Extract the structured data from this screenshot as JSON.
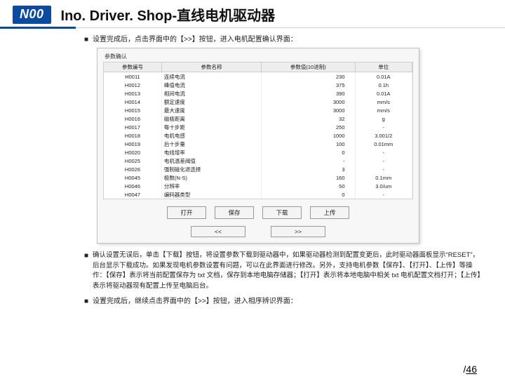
{
  "header": {
    "badge": "N00",
    "title": "Ino. Driver. Shop-直线电机驱动器"
  },
  "bullet1": "设置完成后，点击界面中的【>>】按钮，进入电机配置确认界面：",
  "win": {
    "group_label": "参数确认",
    "columns": [
      "参数编号",
      "参数名称",
      "参数值(10进制)",
      "单位"
    ],
    "rows": [
      {
        "id": "H0011",
        "name": "连续电流",
        "val": "230",
        "unit": "0.01A"
      },
      {
        "id": "H0012",
        "name": "峰值电流",
        "val": "375",
        "unit": "0.1h"
      },
      {
        "id": "H0013",
        "name": "相间电流",
        "val": "390",
        "unit": "0.01A"
      },
      {
        "id": "H0014",
        "name": "额定速度",
        "val": "3000",
        "unit": "mm/s"
      },
      {
        "id": "H0015",
        "name": "最大速度",
        "val": "3000",
        "unit": "mm/s"
      },
      {
        "id": "H0016",
        "name": "磁极距离",
        "val": "32",
        "unit": "g"
      },
      {
        "id": "H0017",
        "name": "每十步距",
        "val": "250",
        "unit": "-"
      },
      {
        "id": "H0018",
        "name": "电机电感",
        "val": "1000",
        "unit": "3.001/2"
      },
      {
        "id": "H0019",
        "name": "后十步量",
        "val": "100",
        "unit": "0.01mm"
      },
      {
        "id": "H0020",
        "name": "电线增率",
        "val": "0",
        "unit": "-"
      },
      {
        "id": "H0025",
        "name": "电机温差阈值",
        "val": "-",
        "unit": "-"
      },
      {
        "id": "H0026",
        "name": "强制磁化退选择",
        "val": "3",
        "unit": "-"
      },
      {
        "id": "H0045",
        "name": "极数(N-S)",
        "val": "160",
        "unit": "0.1mm"
      },
      {
        "id": "H0046",
        "name": "分辨率",
        "val": "50",
        "unit": "3.0/um"
      },
      {
        "id": "H0047",
        "name": "编码器类型",
        "val": "0",
        "unit": "-"
      }
    ],
    "btns1": {
      "open": "打开",
      "save": "保存",
      "download": "下载",
      "upload": "上传"
    },
    "btns2": {
      "prev": "<<",
      "next": ">>"
    }
  },
  "para1": "确认设置无误后，单击【下载】按钮，将设置参数下载到驱动器中，如果驱动器检测到配置变更后，此时驱动器面板显示“RESET”，后台显示下载成功。如果发现电机参数设置有问题，可以在此界面进行修改。另外，支持电机参数【保存】、【打开】、【上传】等操作：【保存】表示将当前配置保存为 txt 文档，保存到本地电脑存储器；【打开】表示将本地电脑中相关 txt 电机配置文档打开；【上传】表示将驱动器现有配置上传至电脑后台。",
  "bullet2": "设置完成后，继续点击界面中的【>>】按钮，进入相序辨识界面：",
  "footer": {
    "slash": "/",
    "page": "46"
  }
}
